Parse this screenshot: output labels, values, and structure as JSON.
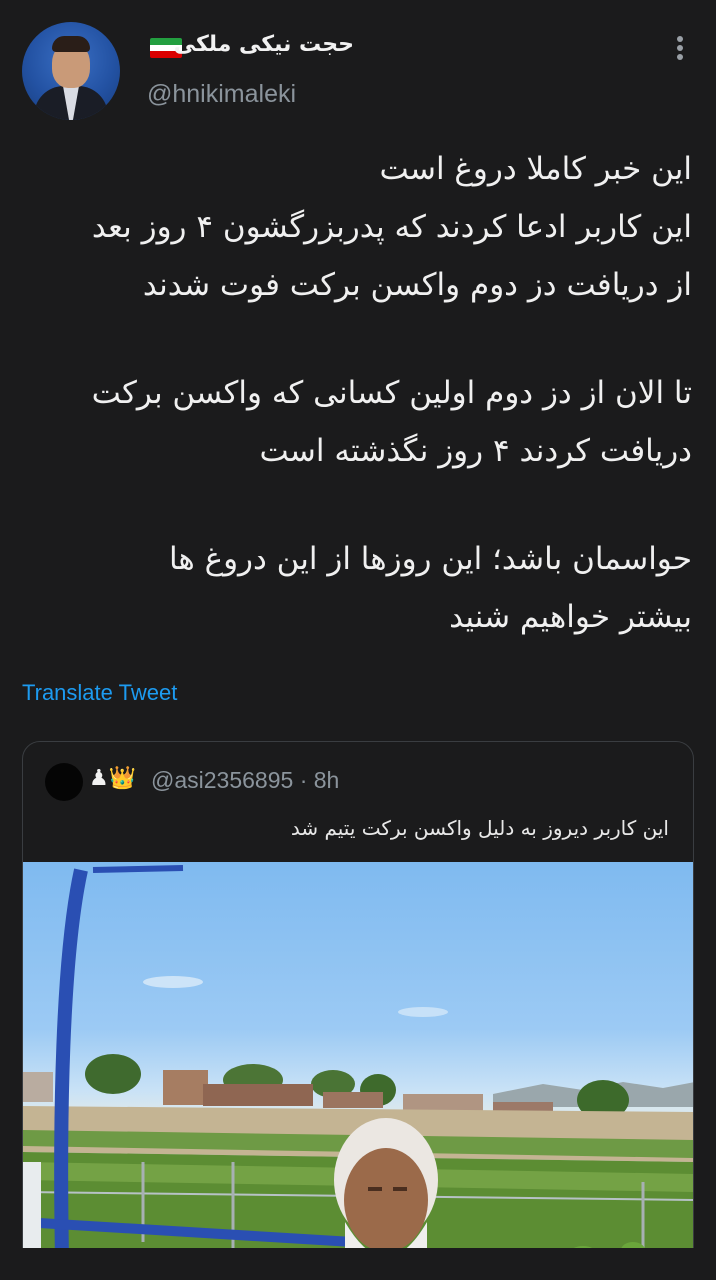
{
  "tweet": {
    "author": {
      "display_name": "حجت نیکی ملکی",
      "flag_icon": "iran-flag-emoji",
      "handle": "@hnikimaleki"
    },
    "lines": [
      "این خبر کاملا دروغ است",
      "این کاربر ادعا کردند که پدربزرگشون ۴ روز بعد",
      "از دریافت دز دوم واکسن برکت فوت شدند",
      "تا الان از دز دوم اولین کسانی که واکسن برکت",
      "دریافت کردند ۴ روز نگذشته است",
      "حواسمان باشد؛ این روزها از این دروغ ها",
      "بیشتر خواهیم شنید"
    ],
    "translate_label": "Translate Tweet"
  },
  "quote": {
    "badges": "♟👑",
    "handle": "@asi2356895",
    "time": "· 8h",
    "text": "این کاربر دیروز به دلیل واکسن برکت یتیم شد"
  },
  "colors": {
    "background": "#1b1b1c",
    "link": "#1d9bf0",
    "muted": "#8b949c"
  }
}
